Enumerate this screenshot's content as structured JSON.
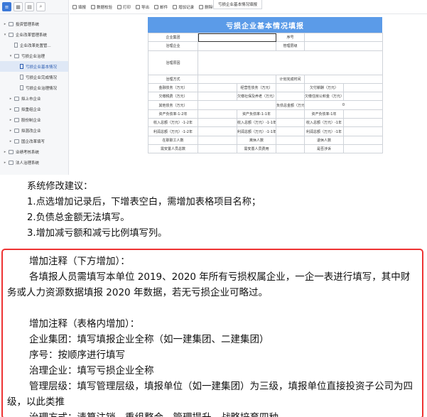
{
  "sidebar": {
    "items": [
      {
        "label": "投资管理系统",
        "level": 0,
        "type": "folder",
        "expanded": false
      },
      {
        "label": "企业改革管理系统",
        "level": 0,
        "type": "folder",
        "expanded": true
      },
      {
        "label": "企业改革处置管...",
        "level": 1,
        "type": "doc"
      },
      {
        "label": "亏损企业治理",
        "level": 1,
        "type": "folder",
        "expanded": true
      },
      {
        "label": "亏损企业基本情况",
        "level": 2,
        "type": "doc",
        "selected": true
      },
      {
        "label": "亏损企业完成情况",
        "level": 2,
        "type": "doc"
      },
      {
        "label": "亏损企业治理情况",
        "level": 2,
        "type": "doc"
      },
      {
        "label": "拟上市企业",
        "level": 1,
        "type": "folder"
      },
      {
        "label": "拟重组企业",
        "level": 1,
        "type": "folder"
      },
      {
        "label": "股份制企业",
        "level": 1,
        "type": "folder"
      },
      {
        "label": "拟混改企业",
        "level": 1,
        "type": "folder"
      },
      {
        "label": "国企改革填写",
        "level": 1,
        "type": "folder"
      },
      {
        "label": "业绩考核系统",
        "level": 0,
        "type": "folder"
      },
      {
        "label": "法人治理系统",
        "level": 0,
        "type": "folder"
      }
    ]
  },
  "toolbar": {
    "buttons": [
      "填报",
      "数据校验",
      "打印",
      "导出",
      "邮件",
      "增加记录",
      "删除行行"
    ],
    "tab": "亏损企业基本情况填报"
  },
  "form": {
    "title": "亏损企业基本情况填报",
    "rows": [
      [
        "企业集团",
        "",
        "序号",
        ""
      ],
      [
        "治理企业",
        "",
        "管理层级",
        ""
      ],
      [
        "治理原因",
        ""
      ],
      [
        "治理方式",
        "",
        "计划完成时间",
        ""
      ],
      [
        "金融债务（万元）",
        "",
        "经营性债务（万元）",
        "",
        "欠付薪酬（万元）",
        ""
      ],
      [
        "欠缴税费（万元）",
        "",
        "欠缴社保及养老（万元）",
        "",
        "欠缴住房公积金（万元）",
        ""
      ],
      [
        "其他债务（万元）",
        "",
        "负债总金额（万元）",
        "0"
      ],
      [
        "资产负债率-1-2年",
        "",
        "资产负债率-1-1年",
        "",
        "资产负债率-1年",
        ""
      ],
      [
        "收入总额（万元）-1-2年",
        "",
        "收入总额（万元）-1-1年",
        "",
        "收入总额（万元）-1年",
        ""
      ],
      [
        "利润总额（万元）-1-2年",
        "",
        "利润总额（万元）-1-1年",
        "",
        "利润总额（万元）-1年",
        ""
      ],
      [
        "在职职工人数",
        "",
        "离休人数",
        "",
        "退休人数",
        ""
      ],
      [
        "需安置人员总数",
        "",
        "需安置人员费用",
        "",
        "是否涉诉",
        ""
      ]
    ]
  },
  "notes": {
    "heading": "系统修改建议：",
    "items": [
      "1.点选增加记录后，下增表空白，需增加表格项目名称；",
      "2.负债总金额无法填写。",
      "3.增加减亏额和减亏比例填写列。"
    ]
  },
  "annotations": {
    "h1": "增加注释（下方增加）：",
    "p1": "各填报人员需填写本单位 2019、2020 年所有亏损权属企业，一企一表进行填写，其中财务或人力资源数据填报 2020 年数据，若无亏损企业可略过。",
    "h2": "增加注释（表格内增加）：",
    "l1": "企业集团：填写填报企业全称（如一建集团、二建集团）",
    "l2": "序号：按顺序进行填写",
    "l3": "治理企业：填写亏损企业全称",
    "l4": "管理层级：填写管理层级，填报单位（如一建集团）为三级，填报单位直接投资子公司为四级，以此类推",
    "l5": "治理方式：清算注销、重组整合、管理提升、战略培育四种"
  },
  "colors": {
    "accent": "#5b9be8",
    "highlight_box": "#ee3333"
  }
}
